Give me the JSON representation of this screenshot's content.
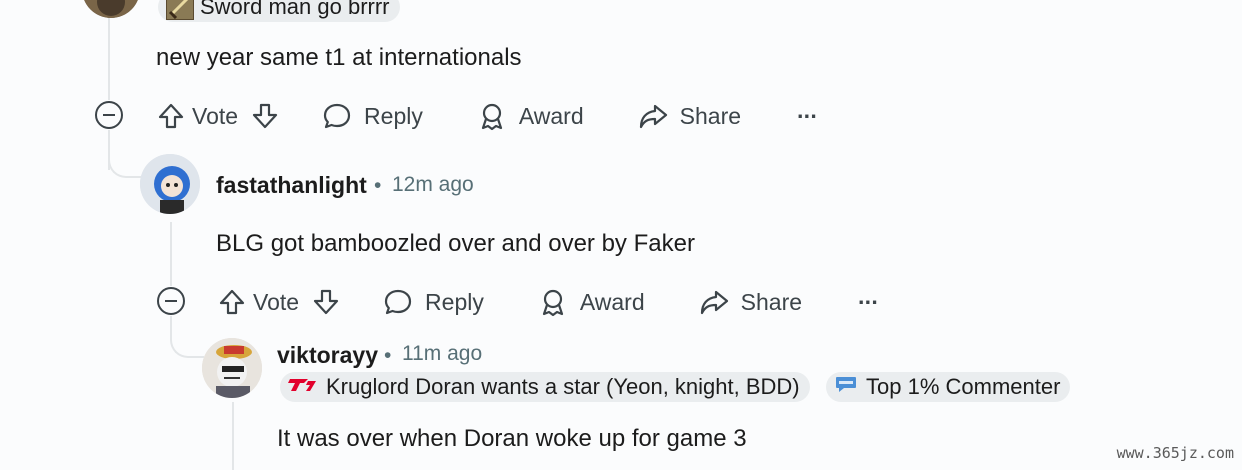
{
  "thread": {
    "top_comment": {
      "flair": "Sword man go brrrr",
      "text": "new year same t1 at internationals"
    },
    "reply1": {
      "username": "fastathanlight",
      "separator": "•",
      "time": "12m ago",
      "text": "BLG got bamboozled over and over by Faker"
    },
    "reply2": {
      "username": "viktorayy",
      "separator": "•",
      "time": "11m ago",
      "flair": "Kruglord Doran wants a star (Yeon, knight, BDD)",
      "badge": "Top 1% Commenter",
      "text": "It was over when Doran woke up for game 3"
    }
  },
  "actions": {
    "vote": "Vote",
    "reply": "Reply",
    "award": "Award",
    "share": "Share",
    "more": "···"
  },
  "watermark": "www.365jz.com",
  "colors": {
    "background": "#fbfcfd",
    "text": "#1c1c1c",
    "muted": "#576f76",
    "action": "#3c4449",
    "thread_line": "#e3e6e8",
    "flair_bg": "#eaedef",
    "t1_red": "#e2012d"
  },
  "icons": [
    "upvote-icon",
    "downvote-icon",
    "reply-bubble-icon",
    "award-icon",
    "share-icon",
    "collapse-icon",
    "more-icon"
  ]
}
